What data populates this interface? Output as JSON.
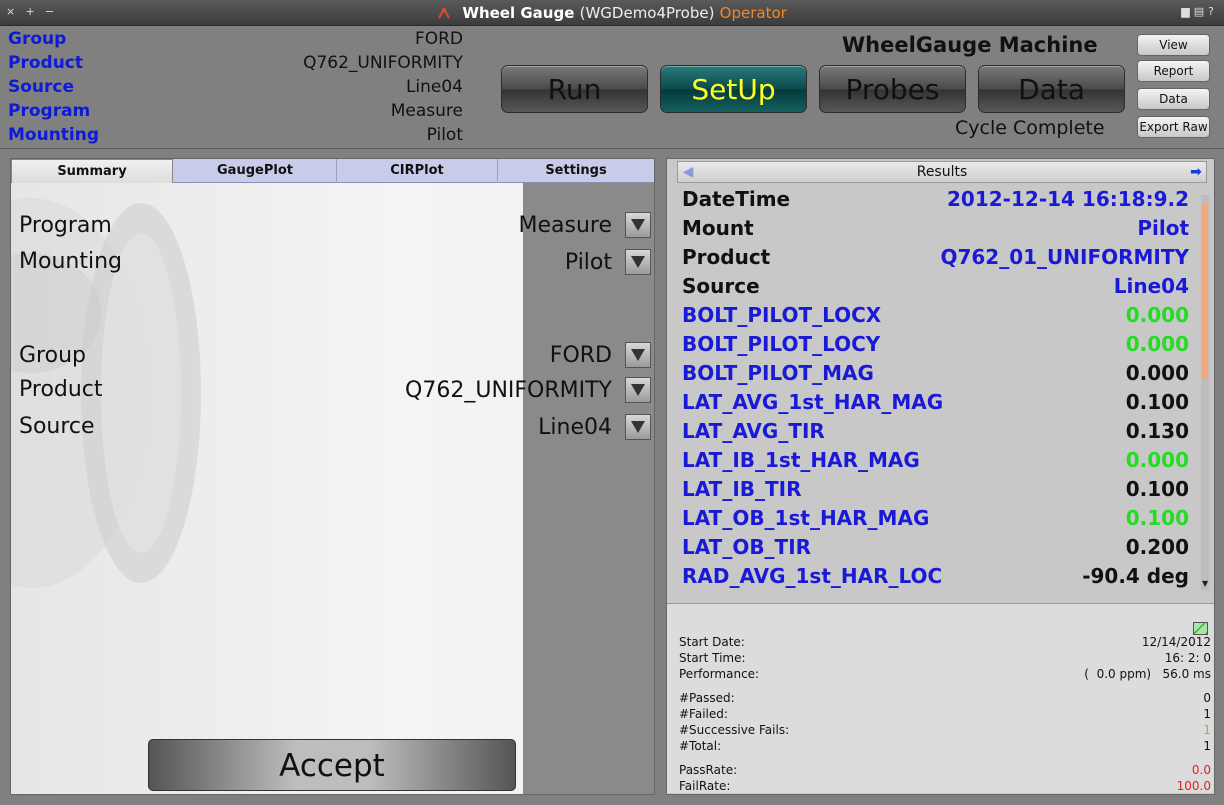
{
  "window": {
    "app_name": "Wheel Gauge",
    "demo_name": "(WGDemo4Probe)",
    "mode": "Operator",
    "controls_left": [
      "×",
      "+",
      "−"
    ]
  },
  "header": {
    "info": [
      {
        "key": "Group",
        "value": "FORD"
      },
      {
        "key": "Product",
        "value": "Q762_UNIFORMITY"
      },
      {
        "key": "Source",
        "value": "Line04"
      },
      {
        "key": "Program",
        "value": "Measure"
      },
      {
        "key": "Mounting",
        "value": "Pilot"
      }
    ],
    "machine_title": "WheelGauge Machine",
    "status": "Cycle Complete",
    "big_buttons": [
      {
        "label": "Run"
      },
      {
        "label": "SetUp"
      },
      {
        "label": "Probes"
      },
      {
        "label": "Data"
      }
    ],
    "active_button": "SetUp",
    "small_buttons": [
      {
        "label": "View"
      },
      {
        "label": "Report"
      },
      {
        "label": "Data"
      },
      {
        "label": "Export Raw"
      }
    ]
  },
  "left_panel": {
    "tabs": [
      {
        "label": "Summary"
      },
      {
        "label": "GaugePlot"
      },
      {
        "label": "CIRPlot"
      },
      {
        "label": "Settings"
      }
    ],
    "active_tab": "Summary",
    "fields": [
      {
        "label": "Program",
        "value": "Measure"
      },
      {
        "label": "Mounting",
        "value": "Pilot"
      },
      {
        "label": "Group",
        "value": "FORD"
      },
      {
        "label": "Product",
        "value": "Q762_UNIFORMITY"
      },
      {
        "label": "Source",
        "value": "Line04"
      }
    ],
    "accept_label": "Accept"
  },
  "results": {
    "title": "Results",
    "rows": [
      {
        "key": "DateTime",
        "value": "2012-12-14 16:18:9.2",
        "key_color": "#111111",
        "value_color": "#1a1ad6"
      },
      {
        "key": "Mount",
        "value": "Pilot",
        "key_color": "#111111",
        "value_color": "#1a1ad6"
      },
      {
        "key": "Product",
        "value": "Q762_01_UNIFORMITY",
        "key_color": "#111111",
        "value_color": "#1a1ad6"
      },
      {
        "key": "Source",
        "value": "Line04",
        "key_color": "#111111",
        "value_color": "#1a1ad6"
      },
      {
        "key": "BOLT_PILOT_LOCX",
        "value": "0.000",
        "key_color": "#1a1ad6",
        "value_color": "#22dd22"
      },
      {
        "key": "BOLT_PILOT_LOCY",
        "value": "0.000",
        "key_color": "#1a1ad6",
        "value_color": "#22dd22"
      },
      {
        "key": "BOLT_PILOT_MAG",
        "value": "0.000",
        "key_color": "#1a1ad6",
        "value_color": "#111111"
      },
      {
        "key": "LAT_AVG_1st_HAR_MAG",
        "value": "0.100",
        "key_color": "#1a1ad6",
        "value_color": "#111111"
      },
      {
        "key": "LAT_AVG_TIR",
        "value": "0.130",
        "key_color": "#1a1ad6",
        "value_color": "#111111"
      },
      {
        "key": "LAT_IB_1st_HAR_MAG",
        "value": "0.000",
        "key_color": "#1a1ad6",
        "value_color": "#22dd22"
      },
      {
        "key": "LAT_IB_TIR",
        "value": "0.100",
        "key_color": "#1a1ad6",
        "value_color": "#111111"
      },
      {
        "key": "LAT_OB_1st_HAR_MAG",
        "value": "0.100",
        "key_color": "#1a1ad6",
        "value_color": "#22dd22"
      },
      {
        "key": "LAT_OB_TIR",
        "value": "0.200",
        "key_color": "#1a1ad6",
        "value_color": "#111111"
      },
      {
        "key": "RAD_AVG_1st_HAR_LOC",
        "value": "-90.4 deg",
        "key_color": "#1a1ad6",
        "value_color": "#111111"
      }
    ]
  },
  "stats": {
    "rows": [
      {
        "key": "Start Date:",
        "value": "12/14/2012",
        "value_color": "#111111"
      },
      {
        "key": "Start Time:",
        "value": "16: 2: 0",
        "value_color": "#111111"
      },
      {
        "key": "Performance:",
        "value": "(  0.0 ppm)   56.0 ms",
        "value_color": "#111111"
      },
      {
        "key": "#Passed:",
        "value": "0",
        "value_color": "#111111"
      },
      {
        "key": "#Failed:",
        "value": "1",
        "value_color": "#111111"
      },
      {
        "key": "#Successive Fails:",
        "value": "1",
        "value_color": "#f0902c"
      },
      {
        "key": "#Total:",
        "value": "1",
        "value_color": "#111111"
      },
      {
        "key": "PassRate:",
        "value": "0.0",
        "value_color": "#e02020"
      },
      {
        "key": "FailRate:",
        "value": "100.0",
        "value_color": "#e02020"
      }
    ]
  }
}
